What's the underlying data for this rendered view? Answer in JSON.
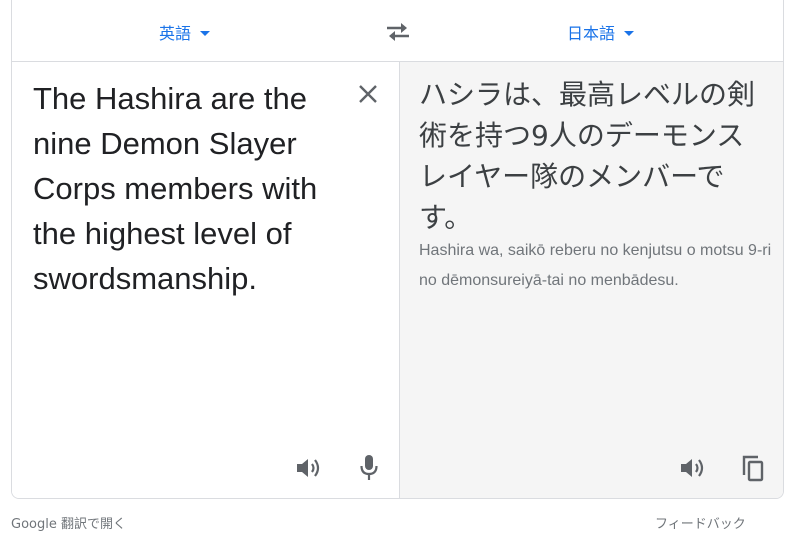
{
  "languages": {
    "source": "英語",
    "target": "日本語"
  },
  "source": {
    "text": "The Hashira are the nine Demon Slayer Corps members with the highest level of swordsmanship."
  },
  "target": {
    "text": "ハシラは、最高レベルの剣術を持つ9人のデーモンスレイヤー隊のメンバーです。",
    "romanization": "Hashira wa, saikō reberu no kenjutsu o motsu 9-ri no dēmonsureiyā-tai no menbādesu."
  },
  "icons": {
    "swap": "swap-arrows-icon",
    "clear": "close-icon",
    "source_speaker": "speaker-icon",
    "mic": "microphone-icon",
    "target_speaker": "speaker-icon",
    "copy": "copy-icon",
    "dropdown": "caret-down-icon"
  },
  "footer": {
    "open_in_translate": "Google 翻訳で開く",
    "feedback": "フィードバック"
  },
  "colors": {
    "accent": "#1a73e8",
    "icon": "#5f6368",
    "target_bg": "#f5f5f5",
    "border": "#dadce0",
    "secondary_text": "#70757a"
  }
}
